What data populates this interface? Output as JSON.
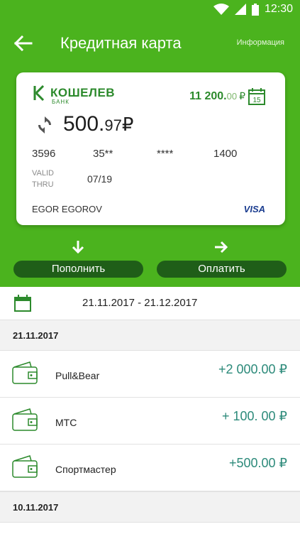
{
  "status_bar": {
    "time": "12:30"
  },
  "app_bar": {
    "title": "Кредитная карта",
    "info_link": "Информация"
  },
  "card": {
    "bank_name": "КОШЕЛЕВ",
    "bank_subtitle": "БАНК",
    "limit_main": "11 200.",
    "limit_decimal": "00",
    "limit_currency": "₽",
    "calendar_day": "15",
    "balance_main": "500.",
    "balance_decimal": "97",
    "balance_currency": "₽",
    "number_groups": [
      "3596",
      "35**",
      "****",
      "1400"
    ],
    "valid_thru_label": "VALID THRU",
    "expiry": "07/19",
    "holder": "EGOR EGOROV",
    "network": "VISA"
  },
  "actions": {
    "topup_label": "Пополнить",
    "pay_label": "Оплатить"
  },
  "period": {
    "range": "21.11.2017 - 21.12.2017"
  },
  "groups": [
    {
      "date": "21.11.2017",
      "transactions": [
        {
          "name": "Pull&Bear",
          "amount": "+2 000.00 ₽"
        },
        {
          "name": "МТС",
          "amount": "+ 100. 00 ₽"
        },
        {
          "name": "Спортмастер",
          "amount": "+500.00 ₽"
        }
      ]
    },
    {
      "date": "10.11.2017",
      "transactions": []
    }
  ],
  "colors": {
    "brand_green": "#4bb31e",
    "dark_green": "#1f5e18",
    "amount_teal": "#2c8a7a"
  }
}
